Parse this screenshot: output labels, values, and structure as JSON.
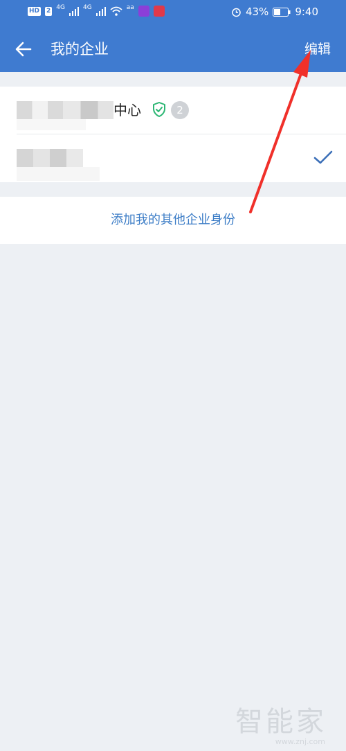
{
  "status_bar": {
    "hd_tag": "HD",
    "sim_tag": "2",
    "net1": "4G",
    "net2": "4G",
    "net_small": "aa",
    "battery": "43%",
    "time": "9:40"
  },
  "header": {
    "title": "我的企业",
    "edit_label": "编辑"
  },
  "companies": [
    {
      "name_visible": "中心",
      "badge_count": "2",
      "verified": true,
      "selected": false
    },
    {
      "name_visible": "",
      "selected": true
    }
  ],
  "actions": {
    "add_identity": "添加我的其他企业身份"
  },
  "watermark": {
    "text": "智能家",
    "sub": "www.znj.com"
  },
  "colors": {
    "brand": "#3f7bd0",
    "link": "#3b7cc6",
    "verified": "#2bb673",
    "annotation_arrow": "#f0302a"
  }
}
